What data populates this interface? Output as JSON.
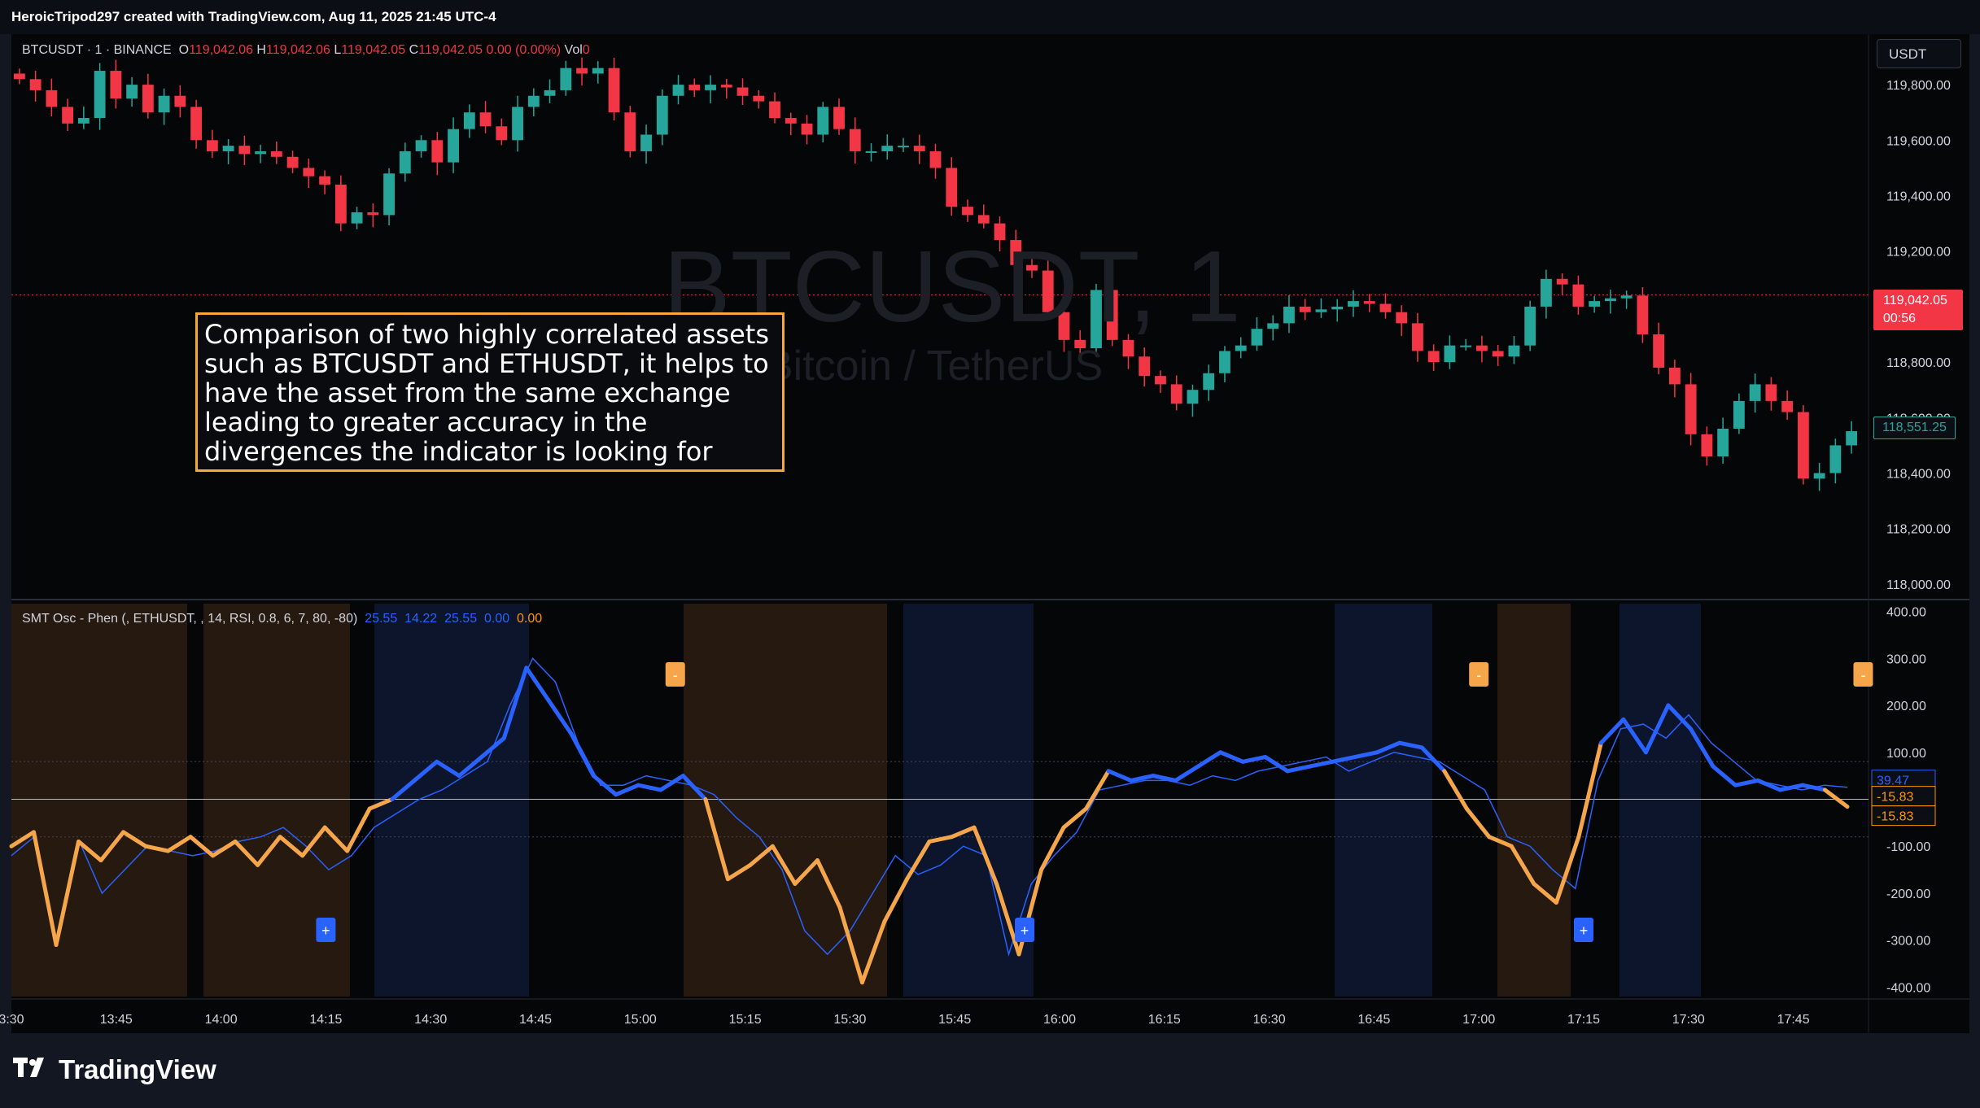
{
  "header": {
    "credit": "HeroicTripod297 created with TradingView.com, Aug 11, 2025 21:45 UTC-4"
  },
  "symbol_legend": {
    "symbol": "BTCUSDT · 1 · BINANCE",
    "o_label": "O",
    "o": "119,042.06",
    "h_label": "H",
    "h": "119,042.06",
    "l_label": "L",
    "l": "119,042.05",
    "c_label": "C",
    "c": "119,042.05",
    "change": "0.00 (0.00%)",
    "vol_label": "Vol",
    "vol": "0"
  },
  "currency_button": "USDT",
  "watermark": {
    "title": "BTCUSDT, 1",
    "subtitle": "Bitcoin / TetherUS"
  },
  "annotation": "Comparison of two highly correlated assets such as BTCUSDT and ETHUSDT, it helps to have the asset from the same exchange leading to greater accuracy in the divergences the indicator is looking for",
  "price_axis": {
    "ticks": [
      "119,800.00",
      "119,600.00",
      "119,400.00",
      "119,200.00",
      "118,800.00",
      "118,600.00",
      "118,400.00",
      "118,200.00",
      "118,000.00"
    ],
    "last_price": "119,042.05",
    "countdown": "00:56",
    "ma_value": "118,551.25"
  },
  "oscillator_legend": {
    "name": "SMT Osc - Phen (, ETHUSDT, , 14, RSI, 0.8, 6, 7, 80, -80)",
    "v1": "25.55",
    "v2": "14.22",
    "v3": "25.55",
    "v4": "0.00",
    "v5": "0.00"
  },
  "oscillator_axis": {
    "ticks": [
      "400.00",
      "300.00",
      "200.00",
      "100.00",
      "-100.00",
      "-200.00",
      "-300.00",
      "-400.00"
    ],
    "tag_blue": "39.47",
    "tag_orange_1": "-15.83",
    "tag_orange_2": "-15.83"
  },
  "signal_labels": {
    "plus": "+",
    "minus": "-"
  },
  "time_axis": [
    "3:30",
    "13:45",
    "14:00",
    "14:15",
    "14:30",
    "14:45",
    "15:00",
    "15:15",
    "15:30",
    "15:45",
    "16:00",
    "16:15",
    "16:30",
    "16:45",
    "17:00",
    "17:15",
    "17:30",
    "17:45"
  ],
  "chart_data": [
    {
      "type": "candlestick",
      "title": "BTCUSDT, 1",
      "xlabel": "",
      "ylabel": "",
      "ylim": [
        117950,
        119900
      ],
      "y_ticks": [
        118000,
        118200,
        118400,
        118600,
        118800,
        119200,
        119400,
        119600,
        119800
      ],
      "x_ticks": [
        "3:30",
        "13:45",
        "14:00",
        "14:15",
        "14:30",
        "14:45",
        "15:00",
        "15:15",
        "15:30",
        "15:45",
        "16:00",
        "16:15",
        "16:30",
        "16:45",
        "17:00",
        "17:15",
        "17:30",
        "17:45"
      ],
      "close": [
        119820,
        119780,
        119720,
        119660,
        119680,
        119850,
        119750,
        119800,
        119700,
        119760,
        119720,
        119600,
        119560,
        119580,
        119550,
        119560,
        119540,
        119500,
        119470,
        119440,
        119300,
        119340,
        119330,
        119480,
        119560,
        119600,
        119520,
        119640,
        119700,
        119650,
        119600,
        119720,
        119760,
        119780,
        119860,
        119840,
        119860,
        119700,
        119560,
        119620,
        119760,
        119800,
        119780,
        119800,
        119790,
        119760,
        119740,
        119680,
        119660,
        119620,
        119720,
        119640,
        119560,
        119560,
        119580,
        119580,
        119560,
        119500,
        119360,
        119330,
        119300,
        119240,
        119150,
        119130,
        118980,
        118880,
        118850,
        119060,
        118880,
        118820,
        118750,
        118720,
        118650,
        118700,
        118760,
        118840,
        118860,
        118920,
        118940,
        119000,
        118980,
        118990,
        119000,
        119020,
        119010,
        118980,
        118940,
        118840,
        118800,
        118860,
        118860,
        118840,
        118820,
        118860,
        119000,
        119100,
        119080,
        119000,
        119020,
        119030,
        119040,
        118900,
        118780,
        118720,
        118540,
        118460,
        118560,
        118660,
        118720,
        118660,
        118620,
        118380,
        118400,
        118500,
        118551
      ],
      "moving_average": {
        "last": 118551.25
      }
    },
    {
      "type": "line",
      "title": "SMT Osc - Phen (, ETHUSDT, , 14, RSI, 0.8, 6, 7, 80, -80)",
      "xlabel": "",
      "ylabel": "",
      "ylim": [
        -420,
        420
      ],
      "y_ticks": [
        -400,
        -300,
        -200,
        -100,
        100,
        200,
        300,
        400
      ],
      "reference_lines": [
        80,
        0,
        -80
      ],
      "series": [],
      "main_line": [
        -100,
        -70,
        -310,
        -90,
        -130,
        -70,
        -100,
        -110,
        -80,
        -120,
        -90,
        -140,
        -80,
        -120,
        -60,
        -110,
        -20,
        0,
        40,
        80,
        50,
        90,
        130,
        280,
        210,
        140,
        50,
        10,
        30,
        20,
        50,
        0,
        -170,
        -140,
        -100,
        -180,
        -130,
        -230,
        -390,
        -260,
        -170,
        -90,
        -80,
        -60,
        -180,
        -330,
        -150,
        -60,
        -20,
        60,
        40,
        50,
        40,
        70,
        100,
        80,
        90,
        60,
        70,
        80,
        90,
        100,
        120,
        110,
        60,
        -20,
        -80,
        -100,
        -180,
        -220,
        -80,
        120,
        170,
        100,
        200,
        150,
        70,
        30,
        40,
        20,
        30,
        20,
        -15.83
      ],
      "thin_line": [
        -120,
        -80,
        -310,
        -90,
        -200,
        -150,
        -100,
        -110,
        -120,
        -110,
        -90,
        -80,
        -60,
        -100,
        -150,
        -120,
        -60,
        -30,
        0,
        20,
        50,
        80,
        200,
        300,
        250,
        120,
        30,
        30,
        50,
        40,
        30,
        10,
        -40,
        -80,
        -150,
        -280,
        -330,
        -280,
        -200,
        -120,
        -160,
        -140,
        -100,
        -120,
        -330,
        -180,
        -120,
        -70,
        20,
        30,
        40,
        40,
        30,
        50,
        40,
        60,
        70,
        80,
        90,
        60,
        80,
        100,
        90,
        80,
        50,
        20,
        -80,
        -100,
        -150,
        -190,
        40,
        150,
        160,
        130,
        180,
        120,
        80,
        40,
        30,
        20,
        30,
        25.55
      ],
      "signals_plus_at": [
        "14:15",
        "15:55",
        "17:15"
      ],
      "signals_minus_at": [
        "15:05",
        "17:00",
        "17:55"
      ]
    }
  ],
  "brand": "TradingView",
  "colors": {
    "up": "#26a69a",
    "down": "#f23645",
    "osc_blue": "#2962ff",
    "osc_orange": "#f5a64a",
    "annotation_border": "#f5a936"
  }
}
